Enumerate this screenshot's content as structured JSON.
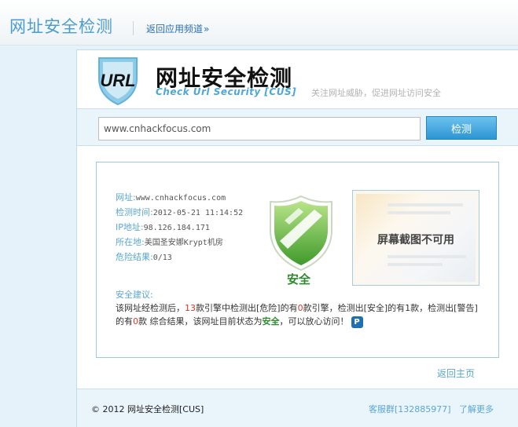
{
  "topbar": {
    "site_title": "网址安全检测",
    "back_channel_label": "返回应用频道",
    "back_channel_chevron": "»"
  },
  "brand": {
    "logo_text": "URL",
    "name_cn": "网址安全检测",
    "name_en": "Check Url Security [CUS]",
    "tagline": "关注网址威胁，促进网址访问安全"
  },
  "search": {
    "url_value": "www.cnhackfocus.com",
    "button_label": "检测"
  },
  "result": {
    "fields": [
      {
        "label": "网址:",
        "value": "www.cnhackfocus.com"
      },
      {
        "label": "检测时间:",
        "value": "2012-05-21 11:14:52"
      },
      {
        "label": "IP地址:",
        "value": "98.126.184.171"
      },
      {
        "label": "所在地:",
        "value": "美国圣安娜Krypt机房"
      },
      {
        "label": "危险结果:",
        "value": "0/13"
      }
    ],
    "status_label": "安全",
    "screenshot_unavailable": "屏幕截图不可用"
  },
  "advice": {
    "title": "安全建议:",
    "p1": "该网址经检测后，",
    "engine_count": "13",
    "p2": "款引擎中检测出[危险]的有",
    "danger_count": "0",
    "p3": "款引擎，检测出[安全]的有1款，检测出[警告]的有",
    "warning_count": "0",
    "p4": "款 综合结果，该网址目前状态为",
    "status": "安全",
    "p5": "，可以放心访问！",
    "icon_glyph": "P"
  },
  "back_home_label": "返回主页",
  "footer": {
    "copyright": "© 2012 网址安全检测[CUS]",
    "qq_group": "客服群[132885977]",
    "more_label": "了解更多"
  },
  "colors": {
    "accent": "#4a9bd0",
    "safe_green": "#2f8a2f",
    "danger_red": "#d9372b",
    "button_blue": "#2d95d3"
  }
}
